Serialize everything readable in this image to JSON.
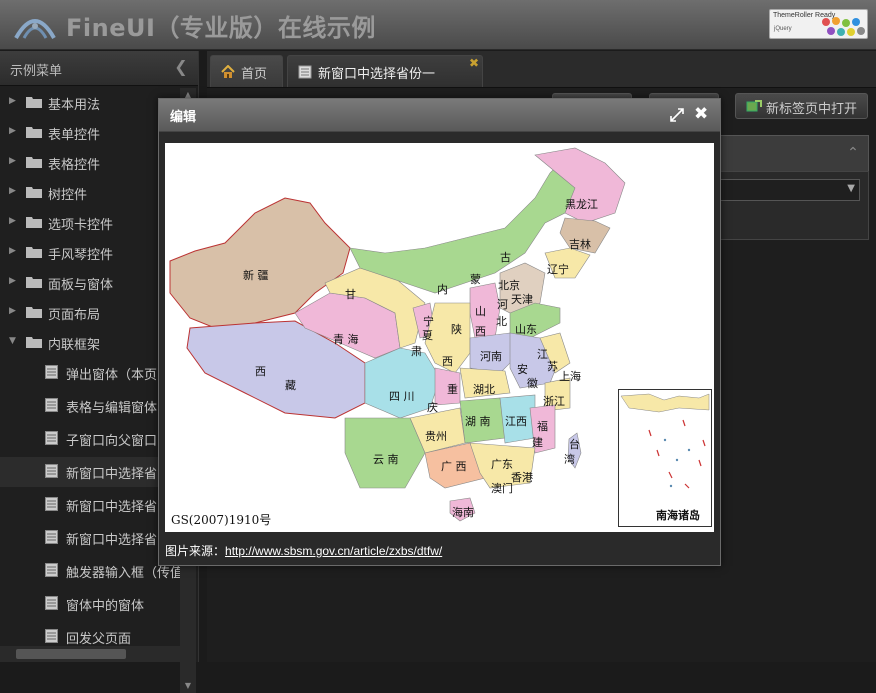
{
  "header": {
    "title": "FineUI（专业版）在线示例",
    "badge_line1": "ThemeRoller Ready",
    "badge_line2": "jQuery"
  },
  "sidebar": {
    "title": "示例菜单",
    "folders": [
      {
        "label": "基本用法",
        "expanded": false
      },
      {
        "label": "表单控件",
        "expanded": false
      },
      {
        "label": "表格控件",
        "expanded": false
      },
      {
        "label": "树控件",
        "expanded": false
      },
      {
        "label": "选项卡控件",
        "expanded": false
      },
      {
        "label": "手风琴控件",
        "expanded": false
      },
      {
        "label": "面板与窗体",
        "expanded": false
      },
      {
        "label": "页面布局",
        "expanded": false
      },
      {
        "label": "内联框架",
        "expanded": true
      }
    ],
    "leaves": [
      {
        "label": "弹出窗体（本页"
      },
      {
        "label": "表格与编辑窗体"
      },
      {
        "label": "子窗口向父窗口"
      },
      {
        "label": "新窗口中选择省"
      },
      {
        "label": "新窗口中选择省"
      },
      {
        "label": "新窗口中选择省"
      },
      {
        "label": "触发器输入框（传值"
      },
      {
        "label": "窗体中的窗体"
      },
      {
        "label": "回发父页面"
      }
    ],
    "selected_leaf_index": 3
  },
  "tabs": [
    {
      "label": "首页"
    },
    {
      "label": "新窗口中选择省份一"
    }
  ],
  "toolbar": {
    "open_new_tab": "新标签页中打开"
  },
  "modal": {
    "title": "编辑",
    "caption_prefix": "图片来源：",
    "caption_link": "http://www.sbsm.gov.cn/article/zxbs/dtfw/",
    "map": {
      "gs_number": "GS(2007)1910号",
      "inset_label": "南海诸岛",
      "provinces": [
        "黑龙江",
        "吉林",
        "辽宁",
        "内",
        "蒙",
        "古",
        "北京",
        "天津",
        "河",
        "北",
        "山",
        "西",
        "山东",
        "新",
        "疆",
        "甘",
        "宁",
        "夏",
        "肃",
        "陕",
        "西",
        "青",
        "海",
        "西",
        "藏",
        "河南",
        "江",
        "苏",
        "安",
        "徽",
        "上海",
        "湖北",
        "重",
        "庆",
        "四",
        "川",
        "浙江",
        "湖南",
        "江西",
        "福",
        "建",
        "贵州",
        "台",
        "湾",
        "云",
        "南",
        "广",
        "西",
        "广东",
        "香港",
        "澳门",
        "海南"
      ]
    }
  }
}
